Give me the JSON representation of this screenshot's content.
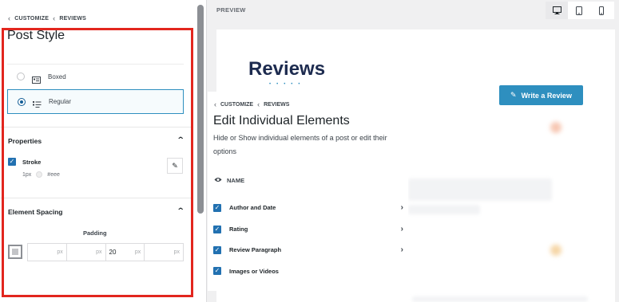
{
  "sidebar": {
    "breadcrumb": [
      "CUSTOMIZE",
      "REVIEWS"
    ],
    "title": "Post Style",
    "style_options": [
      {
        "label": "Boxed",
        "selected": false
      },
      {
        "label": "Regular",
        "selected": true
      }
    ],
    "properties": {
      "heading": "Properties",
      "stroke": {
        "label": "Stroke",
        "width": "1px",
        "color_label": "#eee",
        "checked": true
      }
    },
    "element_spacing": {
      "heading": "Element Spacing",
      "padding_label": "Padding",
      "padding_values": [
        "",
        "",
        "20",
        ""
      ],
      "unit": "px"
    }
  },
  "preview": {
    "label": "PREVIEW",
    "heading": "Reviews",
    "write_button": "Write a Review",
    "devices": [
      "desktop-icon",
      "tablet-icon",
      "mobile-icon"
    ]
  },
  "panel": {
    "breadcrumb": [
      "CUSTOMIZE",
      "REVIEWS"
    ],
    "title": "Edit Individual Elements",
    "description": "Hide or Show individual elements of a post or edit their options",
    "name_label": "NAME",
    "items": [
      {
        "label": "Author and Date",
        "checked": true,
        "has_arrow": true
      },
      {
        "label": "Rating",
        "checked": true,
        "has_arrow": true
      },
      {
        "label": "Review Paragraph",
        "checked": true,
        "has_arrow": true
      },
      {
        "label": "Images or Videos",
        "checked": true,
        "has_arrow": false
      }
    ]
  },
  "colors": {
    "accent": "#2e8fbf",
    "highlight": "#e2261e",
    "checkbox": "#2271b1"
  }
}
